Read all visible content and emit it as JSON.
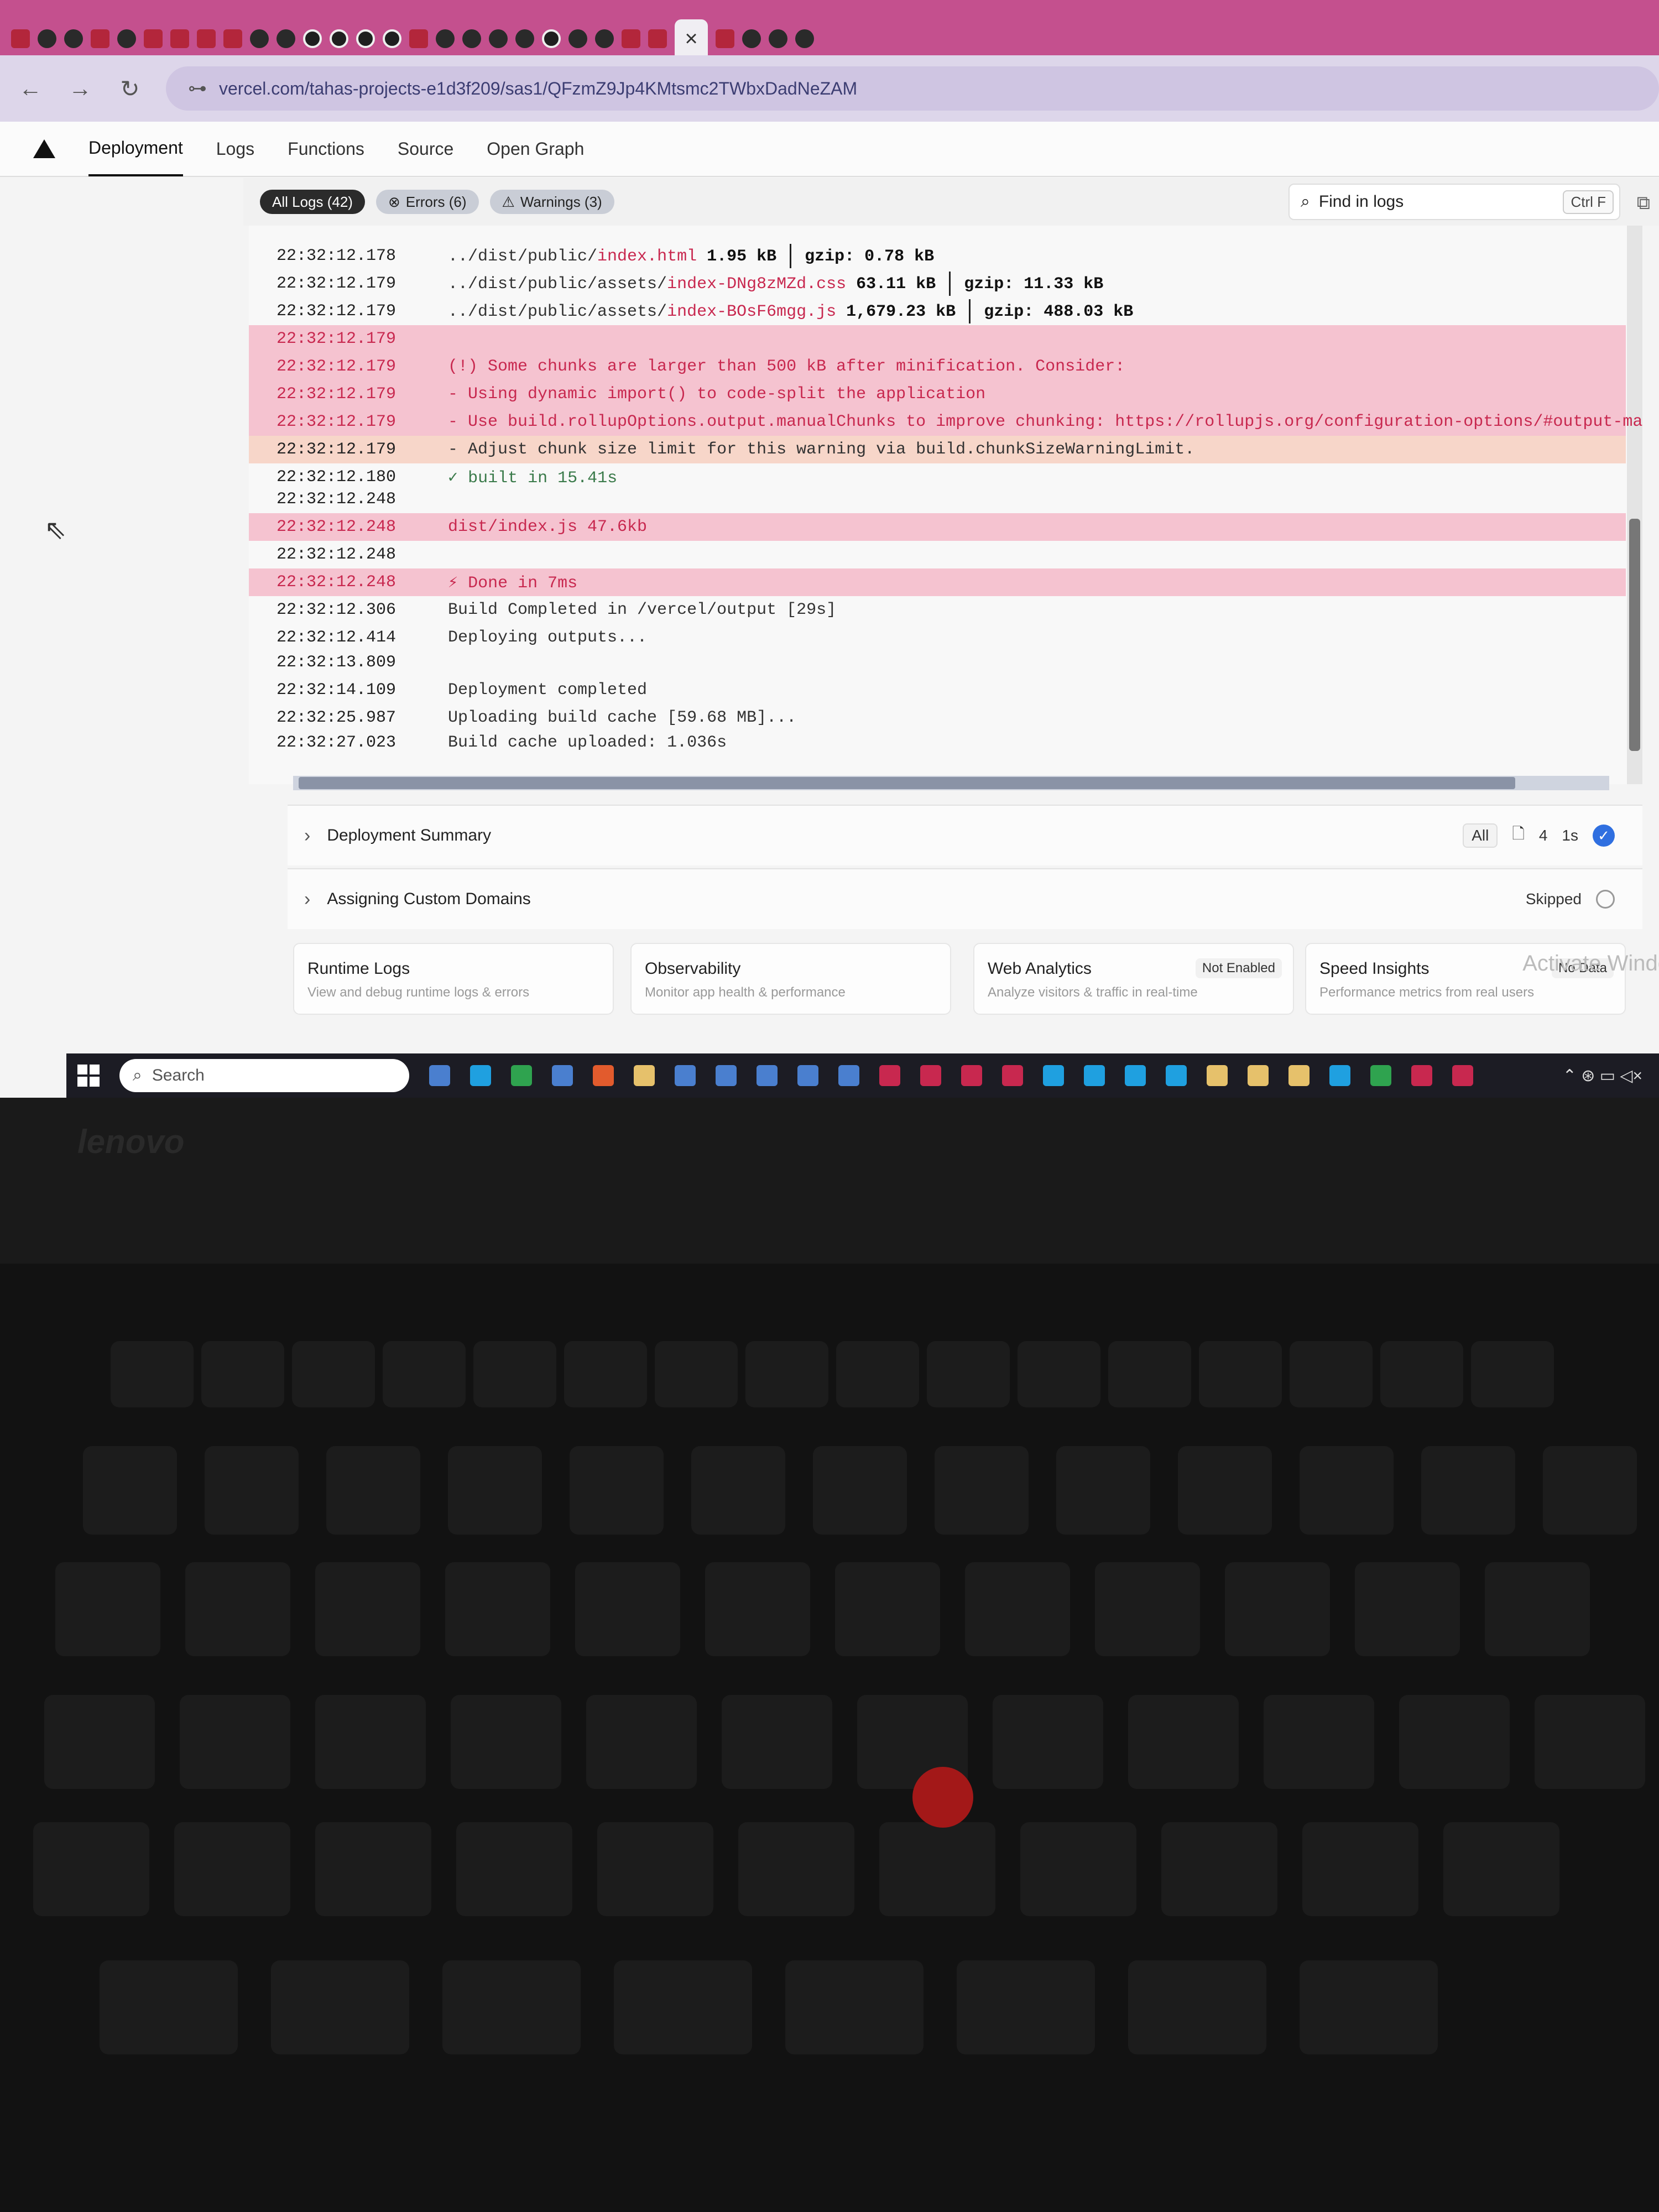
{
  "browser": {
    "active_tab_close": "×",
    "url": "vercel.com/tahas-projects-e1d3f209/sas1/QFzmZ9Jp4KMtsmc2TWbxDadNeZAM",
    "nav": {
      "back": "←",
      "forward": "→",
      "reload": "↻",
      "site_info": "⊶"
    }
  },
  "vercel": {
    "tabs": [
      "Deployment",
      "Logs",
      "Functions",
      "Source",
      "Open Graph"
    ],
    "active_tab": "Deployment"
  },
  "filters": {
    "all": "All Logs (42)",
    "errors": "Errors (6)",
    "warnings": "Warnings (3)",
    "errors_icon": "⊗",
    "warnings_icon": "⚠",
    "find_placeholder": "Find in logs",
    "find_shortcut": "Ctrl F"
  },
  "logs": [
    {
      "ts": "22:32:12.178",
      "type": "normal",
      "parts": [
        "../dist/public/",
        "index.html",
        "1.95 kB",
        "gzip: 0.78 kB"
      ]
    },
    {
      "ts": "22:32:12.179",
      "type": "normal",
      "parts": [
        "../dist/public/assets/",
        "index-DNg8zMZd.css",
        "63.11 kB",
        "gzip: 11.33 kB"
      ]
    },
    {
      "ts": "22:32:12.179",
      "type": "normal",
      "parts": [
        "../dist/public/assets/",
        "index-BOsF6mgg.js",
        "1,679.23 kB",
        "gzip: 488.03 kB"
      ]
    },
    {
      "ts": "22:32:12.179",
      "type": "err",
      "text": ""
    },
    {
      "ts": "22:32:12.179",
      "type": "err",
      "text": "(!) Some chunks are larger than 500 kB after minification. Consider:"
    },
    {
      "ts": "22:32:12.179",
      "type": "err",
      "text": "- Using dynamic import() to code-split the application"
    },
    {
      "ts": "22:32:12.179",
      "type": "err",
      "text": "- Use build.rollupOptions.output.manualChunks to improve chunking: https://rollupjs.org/configuration-options/#output-manua"
    },
    {
      "ts": "22:32:12.179",
      "type": "warn",
      "text": "- Adjust chunk size limit for this warning via build.chunkSizeWarningLimit."
    },
    {
      "ts": "22:32:12.180",
      "type": "ok",
      "text": "✓ built in 15.41s"
    },
    {
      "ts": "22:32:12.248",
      "type": "normal",
      "text": ""
    },
    {
      "ts": "22:32:12.248",
      "type": "err",
      "text": "dist/index.js 47.6kb"
    },
    {
      "ts": "22:32:12.248",
      "type": "normal",
      "text": ""
    },
    {
      "ts": "22:32:12.248",
      "type": "err",
      "text": "⚡ Done in 7ms"
    },
    {
      "ts": "22:32:12.306",
      "type": "normal",
      "text": "Build Completed in /vercel/output [29s]"
    },
    {
      "ts": "22:32:12.414",
      "type": "normal",
      "text": "Deploying outputs..."
    },
    {
      "ts": "22:32:13.809",
      "type": "normal",
      "text": ""
    },
    {
      "ts": "22:32:14.109",
      "type": "normal",
      "text": "Deployment completed"
    },
    {
      "ts": "22:32:25.987",
      "type": "normal",
      "text": "Uploading build cache [59.68 MB]..."
    },
    {
      "ts": "22:32:27.023",
      "type": "normal",
      "text": "Build cache uploaded: 1.036s"
    }
  ],
  "sections": {
    "summary": {
      "label": "Deployment Summary",
      "filter": "All",
      "files": "4",
      "duration": "1s"
    },
    "domains": {
      "label": "Assigning Custom Domains",
      "status": "Skipped"
    }
  },
  "cards": [
    {
      "title": "Runtime Logs",
      "sub": "View and debug runtime logs & errors",
      "badge": ""
    },
    {
      "title": "Observability",
      "sub": "Monitor app health & performance",
      "badge": ""
    },
    {
      "title": "Web Analytics",
      "sub": "Analyze visitors & traffic in real-time",
      "badge": "Not Enabled"
    },
    {
      "title": "Speed Insights",
      "sub": "Performance metrics from real users",
      "badge": "No Data"
    }
  ],
  "watermark": "Activate Windo",
  "taskbar": {
    "search": "Search"
  },
  "laptop": {
    "brand": "lenovo"
  },
  "colors": {
    "error_row": "#f5c3d0",
    "warning_row": "#f7d6c9",
    "error_text": "#c8284f",
    "tab_strip": "#c4508e"
  }
}
